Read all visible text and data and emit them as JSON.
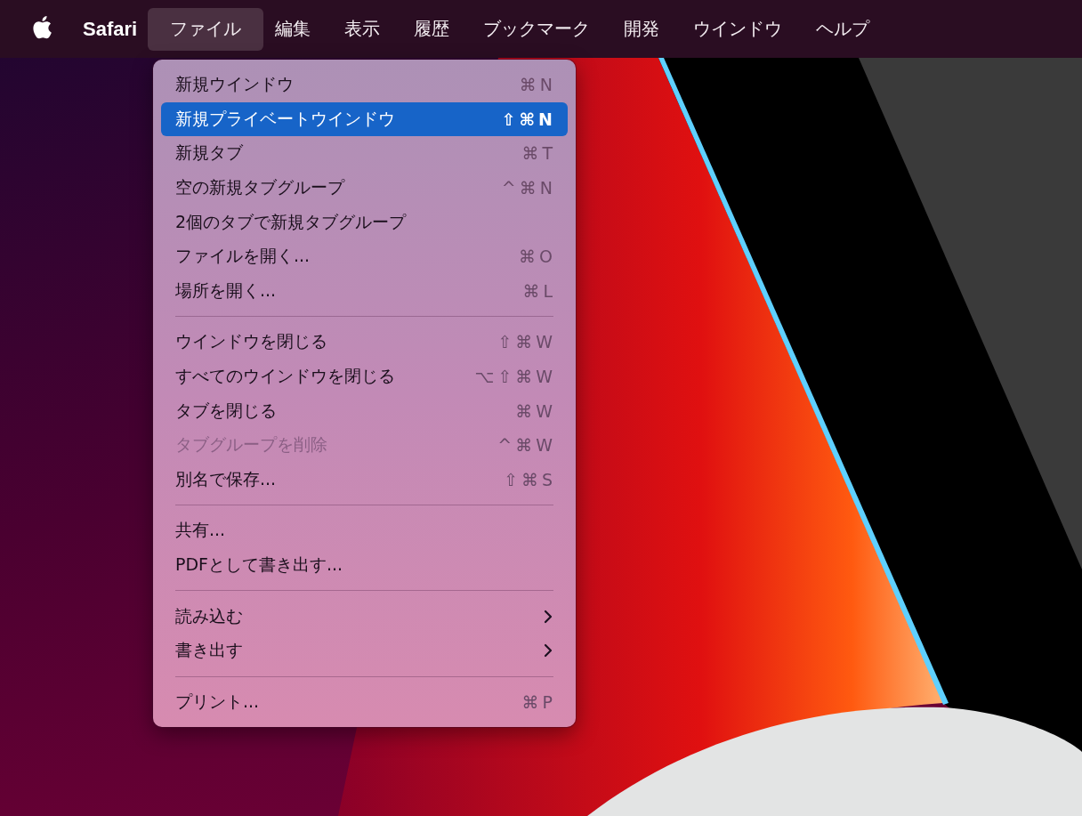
{
  "menu_bar": {
    "app_name": "Safari",
    "menus": [
      {
        "label": "ファイル",
        "selected": true
      },
      {
        "label": "編集",
        "selected": false
      },
      {
        "label": "表示",
        "selected": false
      },
      {
        "label": "履歴",
        "selected": false
      },
      {
        "label": "ブックマーク",
        "selected": false
      },
      {
        "label": "開発",
        "selected": false
      },
      {
        "label": "ウインドウ",
        "selected": false
      },
      {
        "label": "ヘルプ",
        "selected": false
      }
    ]
  },
  "file_menu": {
    "items": [
      {
        "kind": "item",
        "label": "新規ウインドウ",
        "shortcut": "⌘N",
        "selected": false,
        "disabled": false
      },
      {
        "kind": "item",
        "label": "新規プライベートウインドウ",
        "shortcut": "⇧⌘N",
        "selected": true,
        "disabled": false
      },
      {
        "kind": "item",
        "label": "新規タブ",
        "shortcut": "⌘T",
        "selected": false,
        "disabled": false
      },
      {
        "kind": "item",
        "label": "空の新規タブグループ",
        "shortcut": "^⌘N",
        "selected": false,
        "disabled": false
      },
      {
        "kind": "item",
        "label": "2個のタブで新規タブグループ",
        "selected": false,
        "disabled": false
      },
      {
        "kind": "item",
        "label": "ファイルを開く...",
        "shortcut": "⌘O",
        "selected": false,
        "disabled": false
      },
      {
        "kind": "item",
        "label": "場所を開く...",
        "shortcut": "⌘L",
        "selected": false,
        "disabled": false
      },
      {
        "kind": "separator"
      },
      {
        "kind": "item",
        "label": "ウインドウを閉じる",
        "shortcut": "⇧⌘W",
        "selected": false,
        "disabled": false
      },
      {
        "kind": "item",
        "label": "すべてのウインドウを閉じる",
        "shortcut": "⌥⇧⌘W",
        "selected": false,
        "disabled": false
      },
      {
        "kind": "item",
        "label": "タブを閉じる",
        "shortcut": "⌘W",
        "selected": false,
        "disabled": false
      },
      {
        "kind": "item",
        "label": "タブグループを削除",
        "shortcut": "^⌘W",
        "selected": false,
        "disabled": true
      },
      {
        "kind": "item",
        "label": "別名で保存...",
        "shortcut": "⇧⌘S",
        "selected": false,
        "disabled": false
      },
      {
        "kind": "separator"
      },
      {
        "kind": "item",
        "label": "共有...",
        "selected": false,
        "disabled": false
      },
      {
        "kind": "item",
        "label": "PDFとして書き出す...",
        "selected": false,
        "disabled": false
      },
      {
        "kind": "separator"
      },
      {
        "kind": "submenu",
        "label": "読み込む",
        "selected": false,
        "disabled": false
      },
      {
        "kind": "submenu",
        "label": "書き出す",
        "selected": false,
        "disabled": false
      },
      {
        "kind": "separator"
      },
      {
        "kind": "item",
        "label": "プリント...",
        "shortcut": "⌘P",
        "selected": false,
        "disabled": false
      }
    ]
  }
}
